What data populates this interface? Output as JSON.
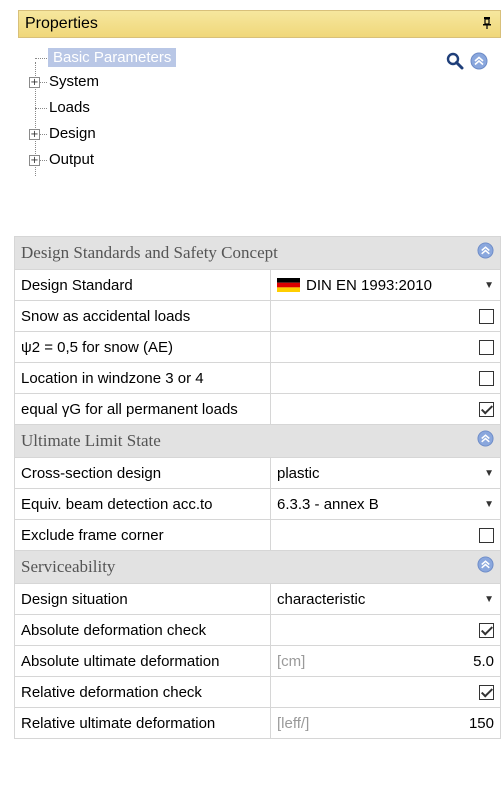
{
  "panel": {
    "title": "Properties"
  },
  "tree": {
    "items": [
      {
        "label": "Basic Parameters",
        "expandable": false,
        "selected": true
      },
      {
        "label": "System",
        "expandable": true,
        "selected": false
      },
      {
        "label": "Loads",
        "expandable": false,
        "selected": false
      },
      {
        "label": "Design",
        "expandable": true,
        "selected": false
      },
      {
        "label": "Output",
        "expandable": true,
        "selected": false
      }
    ],
    "expander_glyph": "+"
  },
  "icons": {
    "pin": "pin-icon",
    "search": "magnifier-icon",
    "collapse": "collapse-up-icon"
  },
  "sections": [
    {
      "title": "Design Standards and Safety Concept",
      "rows": [
        {
          "label": "Design Standard",
          "value": "DIN EN 1993:2010",
          "type": "dropdown",
          "flag": "germany"
        },
        {
          "label": "Snow as accidental loads",
          "type": "checkbox",
          "checked": false
        },
        {
          "label": "ψ2 = 0,5 for snow (AE)",
          "type": "checkbox",
          "checked": false
        },
        {
          "label": "Location in windzone 3 or 4",
          "type": "checkbox",
          "checked": false
        },
        {
          "label": "equal γG for all permanent loads",
          "type": "checkbox",
          "checked": true
        }
      ]
    },
    {
      "title": "Ultimate Limit State",
      "rows": [
        {
          "label": "Cross-section design",
          "value": "plastic",
          "type": "dropdown"
        },
        {
          "label": "Equiv. beam detection acc.to",
          "value": "6.3.3 - annex B",
          "type": "dropdown"
        },
        {
          "label": "Exclude frame corner",
          "type": "checkbox",
          "checked": false
        }
      ]
    },
    {
      "title": "Serviceability",
      "rows": [
        {
          "label": "Design situation",
          "value": "characteristic",
          "type": "dropdown"
        },
        {
          "label": "Absolute deformation check",
          "type": "checkbox",
          "checked": true
        },
        {
          "label": "Absolute ultimate deformation",
          "unit": "[cm]",
          "value": "5.0",
          "type": "number"
        },
        {
          "label": "Relative deformation check",
          "type": "checkbox",
          "checked": true
        },
        {
          "label": "Relative ultimate deformation",
          "unit": "[leff/]",
          "value": "150",
          "type": "number"
        }
      ]
    }
  ],
  "colors": {
    "header_bg": "#f0d77a",
    "selected_bg": "#b9c7e6",
    "section_bg": "#e2e2e2",
    "collapse_icon": "#7f9ed8"
  }
}
